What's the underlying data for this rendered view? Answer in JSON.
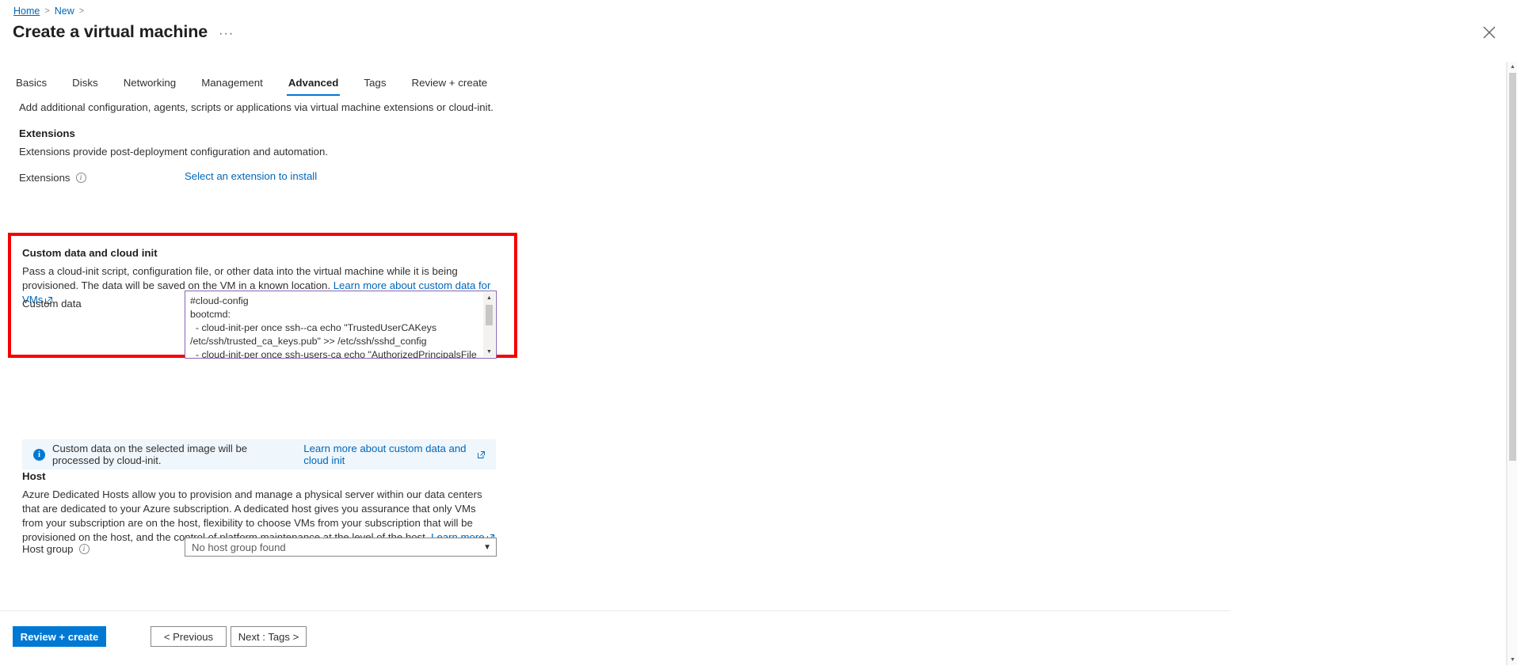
{
  "breadcrumb": {
    "home": "Home",
    "new": "New",
    "sep": ">"
  },
  "header": {
    "title": "Create a virtual machine",
    "ellipsis": "···",
    "close_icon": "close-icon"
  },
  "tabs": [
    {
      "label": "Basics",
      "active": false
    },
    {
      "label": "Disks",
      "active": false
    },
    {
      "label": "Networking",
      "active": false
    },
    {
      "label": "Management",
      "active": false
    },
    {
      "label": "Advanced",
      "active": true
    },
    {
      "label": "Tags",
      "active": false
    },
    {
      "label": "Review + create",
      "active": false
    }
  ],
  "intro": "Add additional configuration, agents, scripts or applications via virtual machine extensions or cloud-init.",
  "extensions": {
    "heading": "Extensions",
    "description": "Extensions provide post-deployment configuration and automation.",
    "field_label": "Extensions",
    "link": "Select an extension to install"
  },
  "custom_data": {
    "heading": "Custom data and cloud init",
    "description_1": "Pass a cloud-init script, configuration file, or other data into the virtual machine while it is being provisioned. The data will be",
    "description_2": "saved on the VM in a known location. ",
    "description_link": "Learn more about custom data for VMs",
    "field_label": "Custom data",
    "value": "#cloud-config\nbootcmd:\n  - cloud-init-per once ssh--ca echo \"TrustedUserCAKeys /etc/ssh/trusted_ca_keys.pub\" >> /etc/ssh/sshd_config\n  - cloud-init-per once ssh-users-ca echo \"AuthorizedPrincipalsFile /etc/ssh/auth_principals/%u\" >> /etc/ssh/sshd_config\n  - cloud-init-per once ssh-users mkdir /etc/ssh/auth_principals"
  },
  "banner": {
    "icon": "info-icon",
    "text": "Custom data on the selected image will be processed by cloud-init. ",
    "link": "Learn more about custom data and cloud init"
  },
  "host": {
    "heading": "Host",
    "description_1": "Azure Dedicated Hosts allow you to provision and manage a physical server within our data centers that are dedicated to your",
    "description_2": "Azure subscription. A dedicated host gives you assurance that only VMs from your subscription are on the host, flexibility to",
    "description_3": "choose VMs from your subscription that will be provisioned on the host, and the control of platform maintenance at the level",
    "description_4": "of the host. ",
    "description_link": "Learn more",
    "host_group_label": "Host group",
    "host_group_value": "No host group found",
    "host_group_caret": "chevron-down-icon"
  },
  "footer": {
    "review_create": "Review + create",
    "previous": "< Previous",
    "next": "Next : Tags >"
  },
  "colors": {
    "accent": "#0078d4",
    "link": "#0067b8",
    "highlight_box": "#f50000",
    "textarea_border": "#8764b8",
    "banner_bg": "#eff6fc"
  }
}
